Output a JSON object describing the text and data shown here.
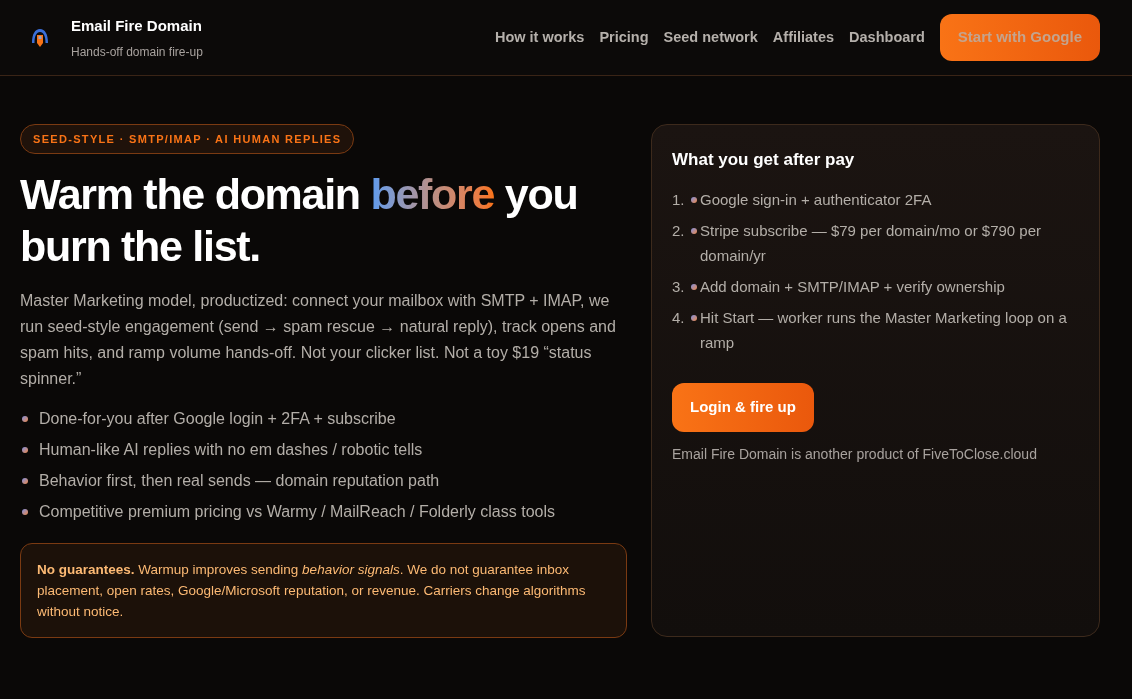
{
  "header": {
    "brand": {
      "title": "Email Fire Domain",
      "subtitle": "Hands-off domain fire-up"
    },
    "nav": [
      "How it works",
      "Pricing",
      "Seed network",
      "Affiliates",
      "Dashboard"
    ],
    "cta": "Start with Google"
  },
  "hero": {
    "badge": "SEED-STYLE · SMTP/IMAP · AI HUMAN REPLIES",
    "headline": {
      "before": "Warm the domain ",
      "highlight": "before",
      "after": " you burn the list."
    },
    "intro": "Master Marketing model, productized: connect your mailbox with SMTP + IMAP, we run seed-style engagement (send → spam rescue → natural reply), track opens and spam hits, and ramp volume hands-off. Not your clicker list. Not a toy $19 “status spinner.”",
    "bullets": [
      "Done-for-you after Google login + 2FA + subscribe",
      "Human-like AI replies with no em dashes / robotic tells",
      "Behavior first, then real sends — domain reputation path",
      "Competitive premium pricing vs Warmy / MailReach / Folderly class tools"
    ],
    "notice": "**No guarantees.** Warmup improves sending *behavior signals*. We do not guarantee inbox placement, open rates, Google/Microsoft reputation, or revenue. Carriers change algorithms without notice."
  },
  "card": {
    "title": "What you get after pay",
    "steps": [
      {
        "number": "1.",
        "text": "Google sign-in + authenticator 2FA"
      },
      {
        "number": "2.",
        "text": "Stripe subscribe — $79 per domain/mo or $790 per domain/yr"
      },
      {
        "number": "3.",
        "text": "Add domain + SMTP/IMAP + verify ownership"
      },
      {
        "number": "4.",
        "text": "Hit Start — worker runs the Master Marketing loop on a ramp"
      }
    ],
    "button": "Login & fire up",
    "footnote": "Email Fire Domain is another product of FiveToClose.cloud"
  }
}
